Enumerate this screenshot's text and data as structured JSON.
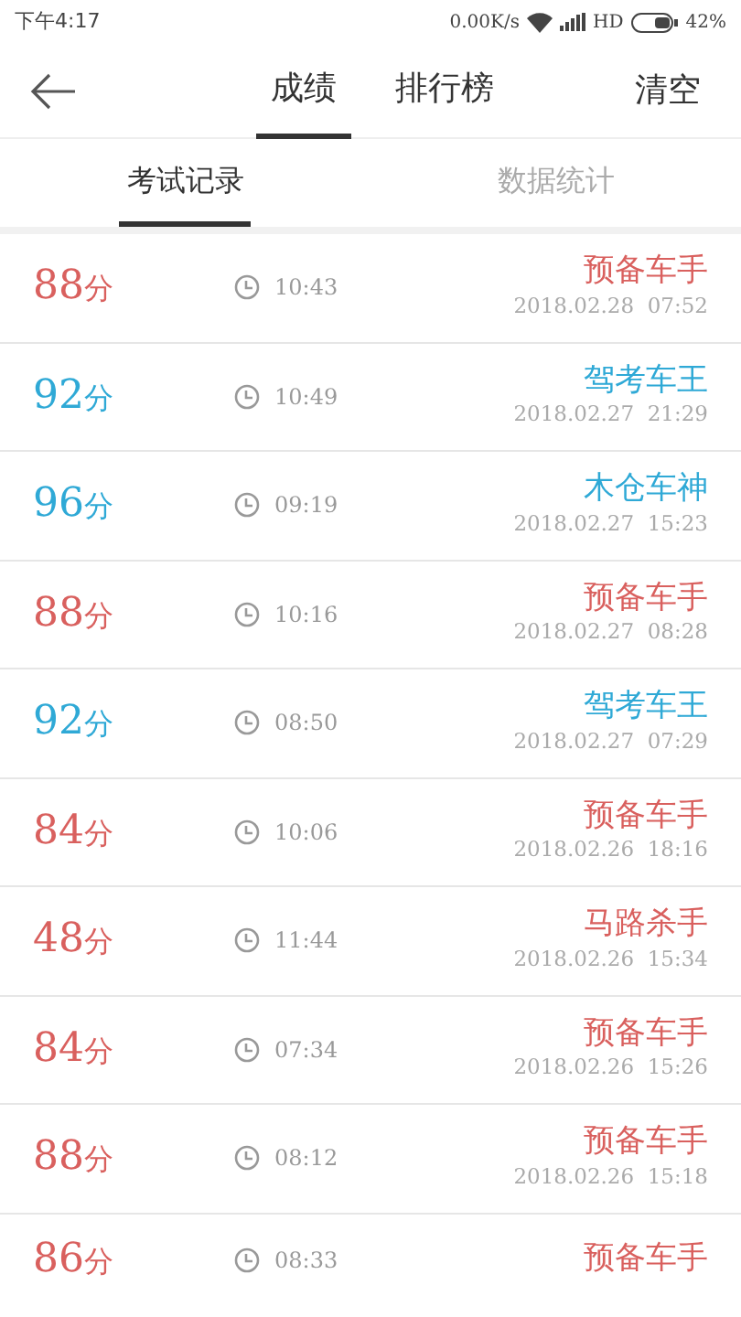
{
  "status_bar": {
    "time": "下午4:17",
    "speed": "0.00K/s",
    "network": "HD",
    "battery": "42%"
  },
  "header": {
    "tabs": [
      {
        "label": "成绩",
        "selected": true
      },
      {
        "label": "排行榜",
        "selected": false
      }
    ],
    "action": "清空"
  },
  "subtabs": [
    {
      "label": "考试记录",
      "selected": true
    },
    {
      "label": "数据统计",
      "selected": false
    }
  ],
  "records": [
    {
      "score": "88",
      "unit": "分",
      "duration": "10:43",
      "title": "预备车手",
      "date": "2018.02.28  07:52",
      "color": "#d9605e"
    },
    {
      "score": "92",
      "unit": "分",
      "duration": "10:49",
      "title": "驾考车王",
      "date": "2018.02.27  21:29",
      "color": "#2fa9d6"
    },
    {
      "score": "96",
      "unit": "分",
      "duration": "09:19",
      "title": "木仓车神",
      "date": "2018.02.27  15:23",
      "color": "#2fa9d6"
    },
    {
      "score": "88",
      "unit": "分",
      "duration": "10:16",
      "title": "预备车手",
      "date": "2018.02.27  08:28",
      "color": "#d9605e"
    },
    {
      "score": "92",
      "unit": "分",
      "duration": "08:50",
      "title": "驾考车王",
      "date": "2018.02.27  07:29",
      "color": "#2fa9d6"
    },
    {
      "score": "84",
      "unit": "分",
      "duration": "10:06",
      "title": "预备车手",
      "date": "2018.02.26  18:16",
      "color": "#d9605e"
    },
    {
      "score": "48",
      "unit": "分",
      "duration": "11:44",
      "title": "马路杀手",
      "date": "2018.02.26  15:34",
      "color": "#d9605e"
    },
    {
      "score": "84",
      "unit": "分",
      "duration": "07:34",
      "title": "预备车手",
      "date": "2018.02.26  15:26",
      "color": "#d9605e"
    },
    {
      "score": "88",
      "unit": "分",
      "duration": "08:12",
      "title": "预备车手",
      "date": "2018.02.26  15:18",
      "color": "#d9605e"
    },
    {
      "score": "86",
      "unit": "分",
      "duration": "08:33",
      "title": "预备车手",
      "color": "#d9605e"
    }
  ]
}
